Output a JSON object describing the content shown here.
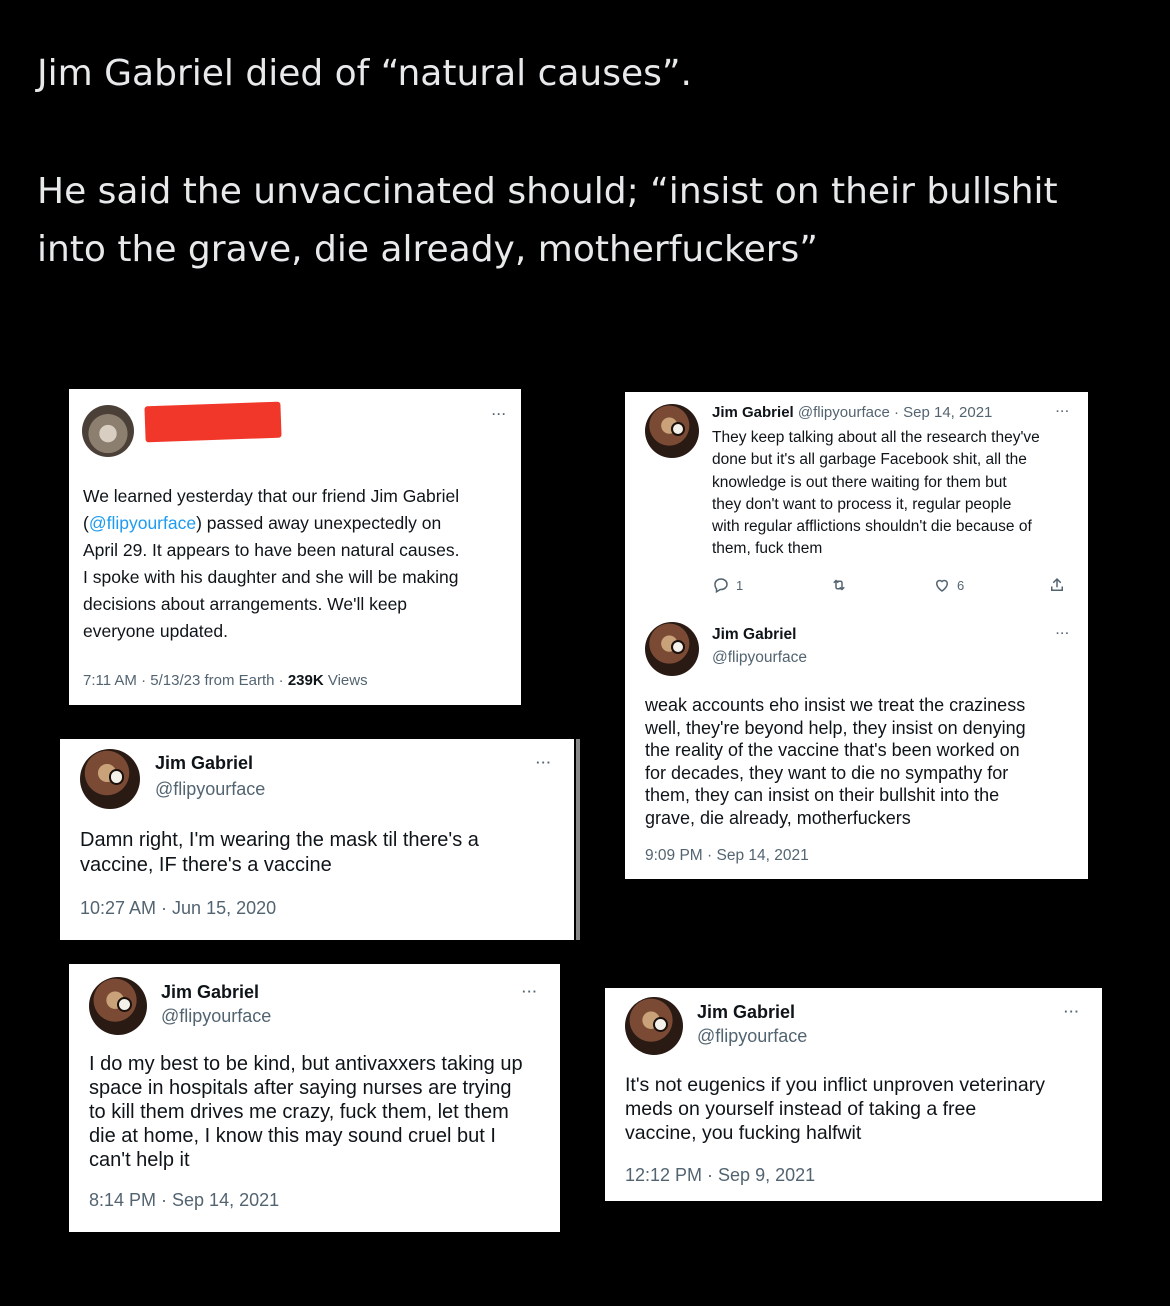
{
  "post": {
    "line1": "Jim Gabriel died of “natural causes”.",
    "line2": "He said the unvaccinated should; “insist on their bullshit",
    "line3": "into the grave, die already, motherfuckers”"
  },
  "card_announcement": {
    "more": "···",
    "text_1": "We learned yesterday that our friend Jim Gabriel",
    "text_2a": "(",
    "text_2_link": "@flipyourface",
    "text_2b": ") passed away unexpectedly on",
    "text_3": "April 29. It appears to have been natural causes.",
    "text_4": "I spoke with his daughter and she will be making",
    "text_5": "decisions about arrangements. We'll keep",
    "text_6": "everyone updated.",
    "meta_prefix": "7:11 AM · 5/13/23 from Earth · ",
    "meta_views_count": "239K",
    "meta_views_label": " Views"
  },
  "card_mask": {
    "name": "Jim Gabriel",
    "handle": "@flipyourface",
    "more": "···",
    "text_1": "Damn right, I'm wearing the mask til there's a",
    "text_2": "vaccine, IF there's a vaccine",
    "meta": "10:27 AM · Jun 15, 2020"
  },
  "card_antivax": {
    "name": "Jim Gabriel",
    "handle": "@flipyourface",
    "more": "···",
    "text_1": "I do my best to be kind, but antivaxxers taking up",
    "text_2": "space in hospitals after saying nurses are trying",
    "text_3": "to kill them drives me crazy, fuck them, let them",
    "text_4": "die at home, I know this may sound cruel but I",
    "text_5": "can't help it",
    "meta": "8:14 PM · Sep 14, 2021"
  },
  "card_research": {
    "name": "Jim Gabriel",
    "handle_date": "@flipyourface · Sep 14, 2021",
    "more": "···",
    "text_1": "They keep talking about all the research they've",
    "text_2": "done but it's all garbage Facebook shit, all the",
    "text_3": "knowledge is out there waiting for them but",
    "text_4": "they don't want to process it, regular people",
    "text_5": "with regular afflictions shouldn't die because of",
    "text_6": "them, fuck them",
    "replies": "1",
    "likes": "6"
  },
  "card_weak": {
    "name": "Jim Gabriel",
    "handle": "@flipyourface",
    "more": "···",
    "text_1": "weak accounts eho insist we treat the craziness",
    "text_2": "well, they're beyond help, they insist on denying",
    "text_3": "the reality of the vaccine that's been worked on",
    "text_4": "for decades, they want to die no sympathy for",
    "text_5": "them, they can insist on their bullshit into the",
    "text_6": "grave, die already, motherfuckers",
    "meta": "9:09 PM · Sep 14, 2021"
  },
  "card_eugenics": {
    "name": "Jim Gabriel",
    "handle": "@flipyourface",
    "more": "···",
    "text_1": "It's not eugenics if you inflict unproven veterinary",
    "text_2": "meds on yourself instead of taking a free",
    "text_3": "vaccine, you fucking halfwit",
    "meta": "12:12 PM · Sep 9, 2021"
  }
}
